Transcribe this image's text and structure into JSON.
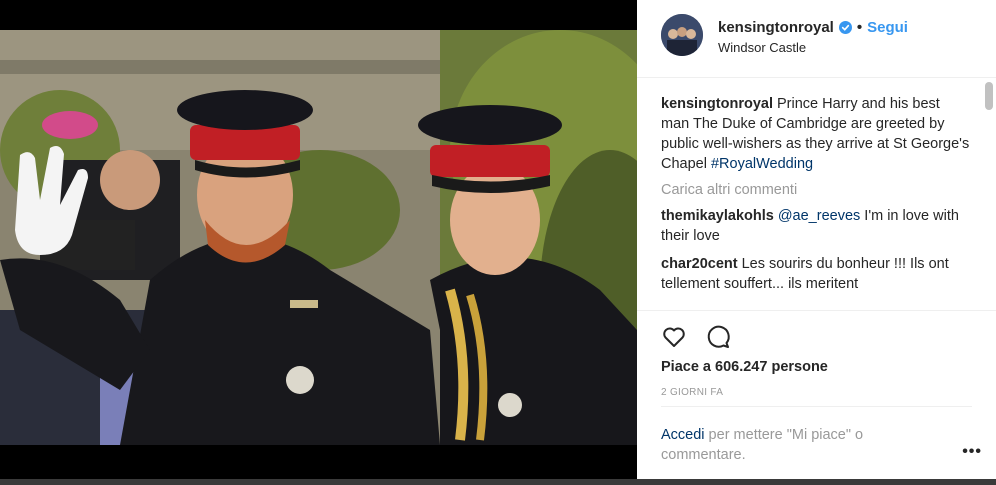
{
  "post": {
    "username": "kensingtonroyal",
    "follow_label": "Segui",
    "separator": "•",
    "location": "Windsor Castle"
  },
  "caption": {
    "username": "kensingtonroyal",
    "text": "Prince Harry and his best man The Duke of Cambridge are greeted by public well-wishers as they arrive at St George's Chapel",
    "hashtag": "#RoyalWedding"
  },
  "load_more_label": "Carica altri commenti",
  "comments": [
    {
      "username": "themikaylakohls",
      "mention": "@ae_reeves",
      "text": "I'm in love with their love"
    },
    {
      "username": "char20cent",
      "mention": "",
      "text": "Les sourirs du bonheur !!! Ils ont tellement souffert... ils meritent"
    }
  ],
  "likes_label": "Piace a 606.247 persone",
  "timestamp": "2 GIORNI FA",
  "login": {
    "link": "Accedi",
    "rest": " per mettere \"Mi piace\" o commentare."
  },
  "more_label": "•••",
  "colors": {
    "link_blue": "#3897f0",
    "dark_link": "#003569",
    "text": "#262626",
    "muted": "#999999"
  },
  "icons": [
    "verified-badge-icon",
    "heart-icon",
    "comment-bubble-icon",
    "more-options-icon"
  ]
}
